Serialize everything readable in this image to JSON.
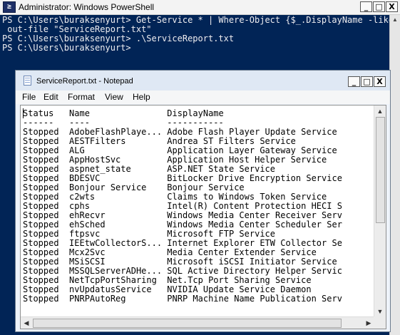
{
  "powershell": {
    "title": "Administrator: Windows PowerShell",
    "icon": "powershell-icon",
    "icon_glyph": "≥",
    "console_text": "PS C:\\Users\\buraksenyurt> Get-Service * | Where-Object {$_.DisplayName -like\n out-file \"ServiceReport.txt\"\nPS C:\\Users\\buraksenyurt> .\\ServiceReport.txt\nPS C:\\Users\\buraksenyurt>",
    "background": "#012456",
    "foreground": "#eeedf0"
  },
  "window_buttons": {
    "minimize": "_",
    "maximize": "□",
    "close": "X"
  },
  "notepad": {
    "title": "ServiceReport.txt - Notepad",
    "menu": [
      "File",
      "Edit",
      "Format",
      "View",
      "Help"
    ],
    "content": "Status   Name               DisplayName\n------   ----               -----------\nStopped  AdobeFlashPlaye... Adobe Flash Player Update Service\nStopped  AESTFilters        Andrea ST Filters Service\nStopped  ALG                Application Layer Gateway Service\nStopped  AppHostSvc         Application Host Helper Service\nStopped  aspnet_state       ASP.NET State Service\nStopped  BDESVC             BitLocker Drive Encryption Service\nStopped  Bonjour Service    Bonjour Service\nStopped  c2wts              Claims to Windows Token Service\nStopped  cphs               Intel(R) Content Protection HECI S\nStopped  ehRecvr            Windows Media Center Receiver Serv\nStopped  ehSched            Windows Media Center Scheduler Ser\nStopped  ftpsvc             Microsoft FTP Service\nStopped  IEEtwCollectorS... Internet Explorer ETW Collector Se\nStopped  Mcx2Svc            Media Center Extender Service\nStopped  MSiSCSI            Microsoft iSCSI Initiator Service\nStopped  MSSQLServerADHe... SQL Active Directory Helper Servic\nStopped  NetTcpPortSharing  Net.Tcp Port Sharing Service\nStopped  nvUpdatusService   NVIDIA Update Service Daemon\nStopped  PNRPAutoReg        PNRP Machine Name Publication Serv"
  },
  "scroll_arrows": {
    "up": "▲",
    "down": "▼",
    "left": "◀",
    "right": "▶"
  }
}
